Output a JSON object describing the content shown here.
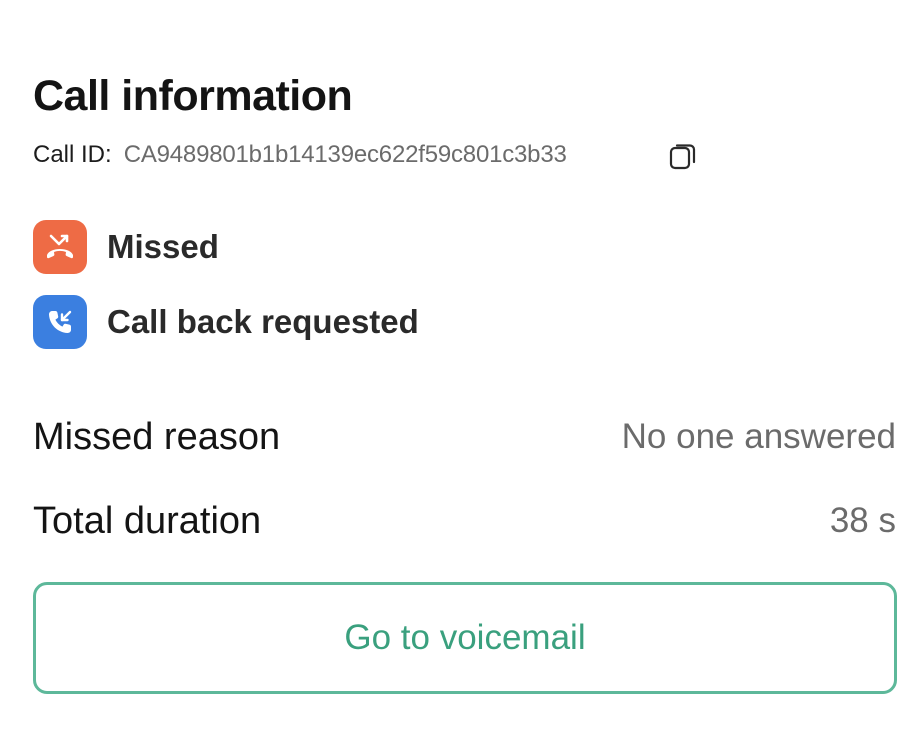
{
  "header": {
    "title": "Call information",
    "call_id_label": "Call ID:",
    "call_id_value": "CA9489801b1b14139ec622f59c801c3b33",
    "copy_icon": "copy-icon"
  },
  "statuses": [
    {
      "label": "Missed",
      "icon": "missed-call-icon",
      "color": "#EE6B45"
    },
    {
      "label": "Call back requested",
      "icon": "callback-icon",
      "color": "#3B7FE0"
    }
  ],
  "details": [
    {
      "label": "Missed reason",
      "value": "No one answered"
    },
    {
      "label": "Total duration",
      "value": "38 s"
    }
  ],
  "actions": {
    "voicemail_label": "Go to voicemail",
    "accent": "#5DB89A"
  }
}
